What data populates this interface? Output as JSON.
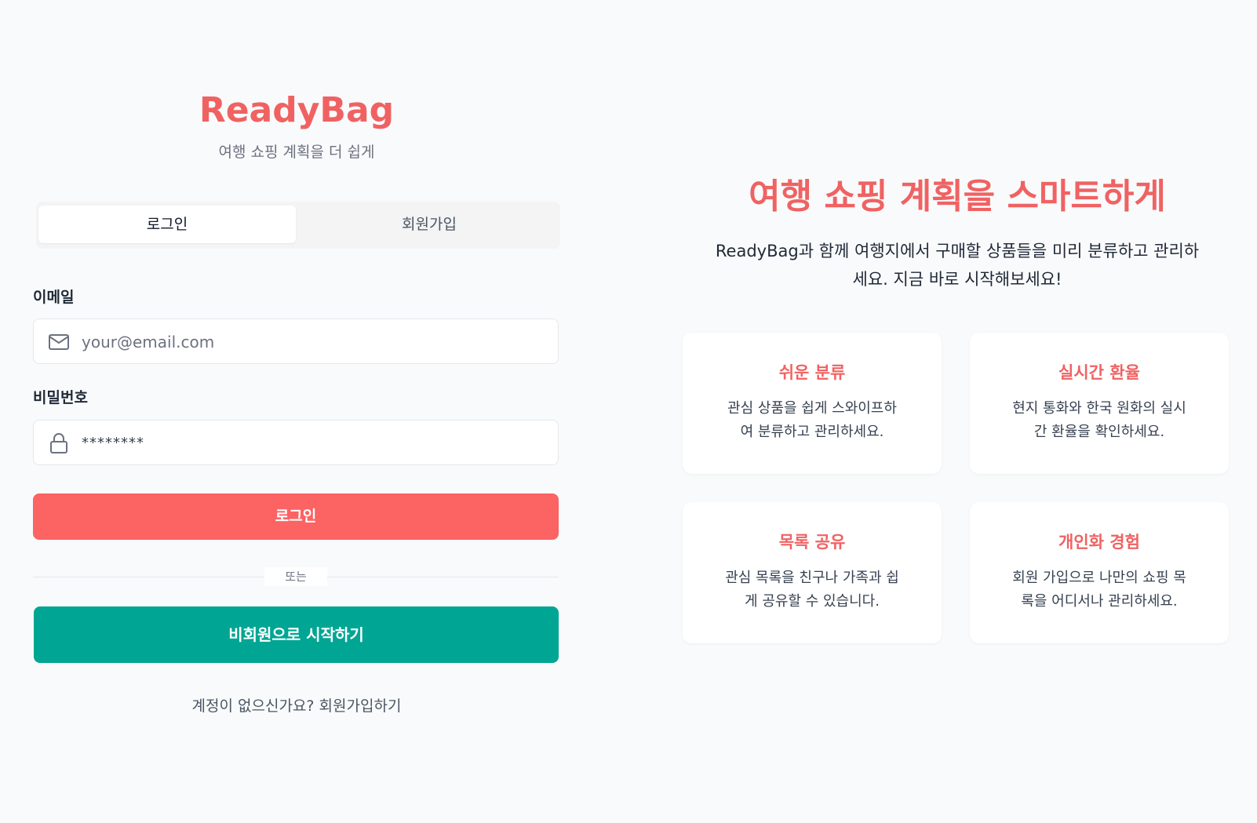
{
  "login_panel": {
    "brand": "ReadyBag",
    "tagline": "여행 쇼핑 계획을 더 쉽게",
    "tabs": [
      {
        "label": "로그인",
        "active": true
      },
      {
        "label": "회원가입",
        "active": false
      }
    ],
    "email": {
      "label": "이메일",
      "placeholder": "your@email.com",
      "icon": "mail-icon"
    },
    "password": {
      "label": "비밀번호",
      "placeholder": "********",
      "icon": "lock-icon"
    },
    "login_button": "로그인",
    "divider_text": "또는",
    "guest_button": "비회원으로 시작하기",
    "signup_hint": "계정이 없으신가요? 회원가입하기"
  },
  "hero": {
    "title": "여행 쇼핑 계획을 스마트하게",
    "description_line1": "ReadyBag과 함께 여행지에서 구매할 상품들을 미리 분류하고 관리하",
    "description_line2": "세요. 지금 바로 시작해보세요!",
    "features": [
      {
        "title": "쉬운 분류",
        "line1": "관심 상품을 쉽게 스와이프하",
        "line2": "여 분류하고 관리하세요."
      },
      {
        "title": "실시간 환율",
        "line1": "현지 통화와 한국 원화의 실시",
        "line2": "간 환율을 확인하세요."
      },
      {
        "title": "목록 공유",
        "line1": "관심 목록을 친구나 가족과 쉽",
        "line2": "게 공유할 수 있습니다."
      },
      {
        "title": "개인화 경험",
        "line1": "회원 가입으로 나만의 쇼핑 목",
        "line2": "록을 어디서나 관리하세요."
      }
    ]
  },
  "colors": {
    "brand": "#f06262",
    "login_button": "#fc6363",
    "guest_button": "#00a693",
    "background": "#f9fafb"
  }
}
